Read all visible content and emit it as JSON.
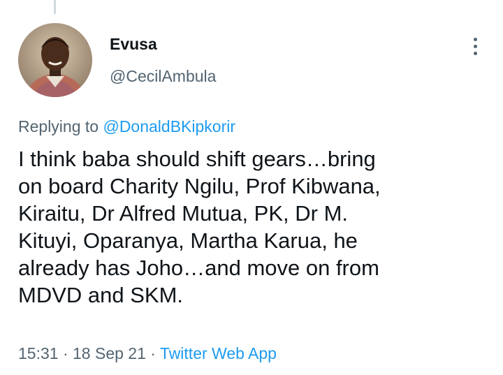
{
  "tweet": {
    "display_name": "Evusa",
    "handle": "@CecilAmbula",
    "replying_prefix": "Replying to ",
    "replying_to": "@DonaldBKipkorir",
    "text": "I think baba should shift gears…bring\non board Charity Ngilu, Prof Kibwana,\nKiraitu, Dr Alfred Mutua, PK, Dr M.\nKituyi, Oparanya, Martha Karua, he\nalready has Joho…and move on from\nMDVD and SKM.",
    "time": "15:31",
    "separator": " · ",
    "date": "18 Sep 21",
    "source": "Twitter Web App"
  },
  "icons": {
    "more": "more-vertical-icon",
    "avatar": "user-avatar"
  },
  "colors": {
    "text": "#0f1419",
    "secondary": "#536471",
    "link": "#1d9bf0",
    "thread_line": "#cfd9de"
  }
}
